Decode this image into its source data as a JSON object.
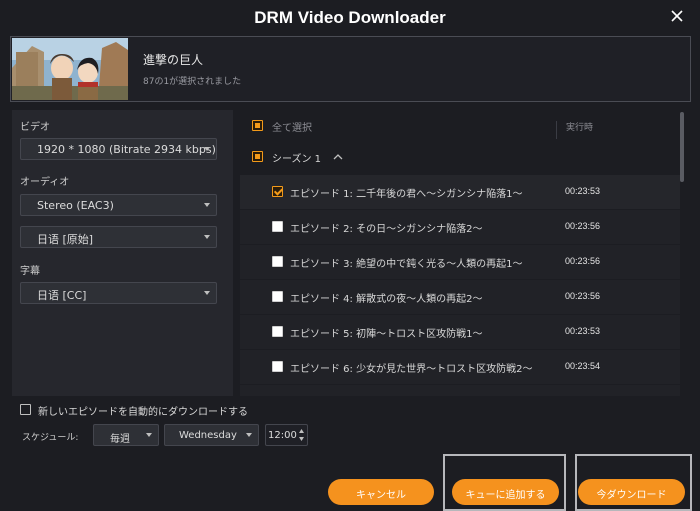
{
  "window": {
    "title": "DRM Video Downloader"
  },
  "show": {
    "title": "進撃の巨人",
    "selection_status": "87の1が選択されました"
  },
  "left_panel": {
    "video_label": "ビデオ",
    "video_value": "1920 * 1080 (Bitrate 2934 kbps)",
    "audio_label": "オーディオ",
    "audio_value": "Stereo (EAC3)",
    "audio_language": "日语 [原始]",
    "subtitle_label": "字幕",
    "subtitle_value": "日语 [CC]"
  },
  "episode_list": {
    "select_all_label": "全て選択",
    "runtime_header": "実行時",
    "season_label": "シーズン 1",
    "episodes": [
      {
        "title": "エピソード 1: 二千年後の君へ～シガンシナ陥落1～",
        "time": "00:23:53",
        "checked": true
      },
      {
        "title": "エピソード 2: その日～シガンシナ陥落2～",
        "time": "00:23:56",
        "checked": false
      },
      {
        "title": "エピソード 3: 絶望の中で鈍く光る～人類の再起1～",
        "time": "00:23:56",
        "checked": false
      },
      {
        "title": "エピソード 4: 解散式の夜～人類の再起2～",
        "time": "00:23:56",
        "checked": false
      },
      {
        "title": "エピソード 5: 初陣～トロスト区攻防戦1～",
        "time": "00:23:53",
        "checked": false
      },
      {
        "title": "エピソード 6: 少女が見た世界～トロスト区攻防戦2～",
        "time": "00:23:54",
        "checked": false
      }
    ]
  },
  "auto_download": {
    "label": "新しいエピソードを自動的にダウンロードする",
    "schedule_label": "スケジュール:",
    "frequency": "毎週",
    "weekday": "Wednesday",
    "time": "12:00"
  },
  "buttons": {
    "cancel": "キャンセル",
    "add_to_queue": "キューに追加する",
    "download_now": "今ダウンロード"
  },
  "colors": {
    "accent": "#f5921e",
    "background": "#1c1d22",
    "panel": "#26272d"
  }
}
